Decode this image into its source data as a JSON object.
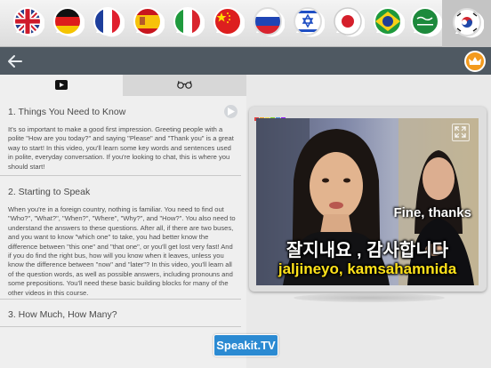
{
  "languages": [
    {
      "icon": "uk-flag-icon",
      "label": ""
    },
    {
      "icon": "germany-flag-icon",
      "label": ""
    },
    {
      "icon": "france-flag-icon",
      "label": ""
    },
    {
      "icon": "spain-flag-icon",
      "label": ""
    },
    {
      "icon": "italy-flag-icon",
      "label": ""
    },
    {
      "icon": "china-flag-icon",
      "label": ""
    },
    {
      "icon": "russia-flag-icon",
      "label": ""
    },
    {
      "icon": "israel-flag-icon",
      "label": ""
    },
    {
      "icon": "japan-flag-icon",
      "label": ""
    },
    {
      "icon": "brazil-flag-icon",
      "label": ""
    },
    {
      "icon": "saudi-arabia-flag-icon",
      "label": ""
    },
    {
      "icon": "south-korea-flag-icon",
      "label": "",
      "active": true
    }
  ],
  "toolbar": {
    "back_icon": "arrow-left-icon",
    "premium_icon": "crown-icon",
    "colors": {
      "bar": "#4f5962",
      "crown": "#f39a1d"
    }
  },
  "tabs": [
    {
      "icon": "video-icon",
      "selected": true
    },
    {
      "icon": "glasses-icon",
      "selected": false
    }
  ],
  "lessons": [
    {
      "title": "1. Things You Need to Know",
      "body": "It's so important to make a good first impression. Greeting people with a polite \"How are you today?\" and saying \"Please\" and \"Thank you\" is a great way to start! In this video, you'll learn some key words and sentences used in polite, everyday conversation. If you're looking to chat, this is where you should start!"
    },
    {
      "title": "2. Starting to Speak",
      "body": "When you're in a foreign country, nothing is familiar. You need to find out \"Who?\", \"What?\", \"When?\", \"Where\", \"Why?\", and \"How?\". You also need to understand the answers to these questions. After all, if there are two buses, and you want to know \"which one\" to take, you had better know the difference between \"this one\" and \"that one\", or you'll get lost very fast! And if you do find the right bus, how will you know when it leaves, unless you know the difference between \"now\" and \"later\"? In this video, you'll learn all of the question words, as well as possible answers, including pronouns and some prepositions. You'll need these basic building blocks for many of the other videos in this course."
    },
    {
      "title": "3. How Much, How Many?",
      "body": ""
    }
  ],
  "video": {
    "caption_en": "Fine, thanks",
    "caption_ko": "잘지내요 , 감사합니다",
    "caption_romanized": "jaljineyo, kamsahamnida",
    "expand_icon": "expand-icon",
    "caption_color": "#ffe21a"
  },
  "brand": {
    "label": "Speakit.TV",
    "color": "#2b8ad2"
  }
}
